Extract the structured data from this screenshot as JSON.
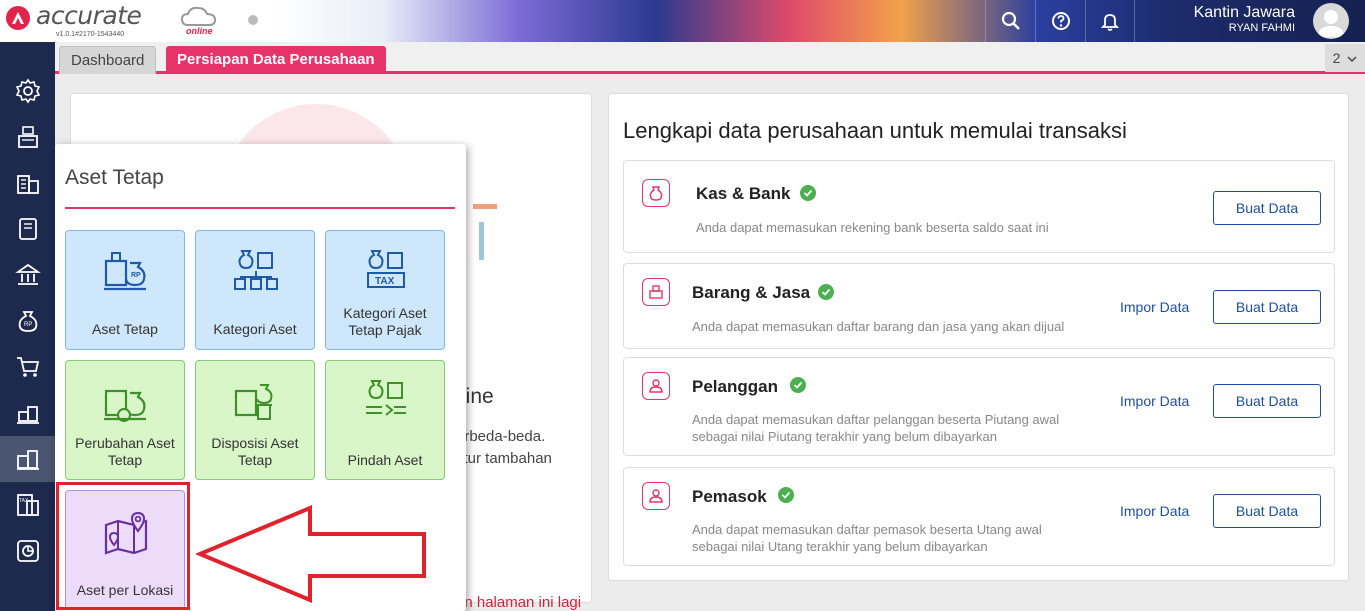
{
  "app": {
    "brand": "accurate",
    "brand_sub": "online",
    "version": "v1.0.1#2170-1543440"
  },
  "user": {
    "company": "Kantin Jawara",
    "name": "RYAN FAHMI"
  },
  "tabs": [
    {
      "label": "Dashboard"
    },
    {
      "label": "Persiapan Data Perusahaan"
    }
  ],
  "tab_count": "2",
  "left_card": {
    "text_online": "line",
    "text_line1": "erbeda-beda.",
    "text_line2": "fitur tambahan",
    "footer": "an halaman ini lagi"
  },
  "right_card": {
    "title": "Lengkapi data perusahaan untuk memulai transaksi",
    "tasks": [
      {
        "title": "Kas & Bank",
        "desc1": "Anda dapat memasukan rekening bank beserta saldo saat ini",
        "desc2": "",
        "impor": "",
        "buat": "Buat Data"
      },
      {
        "title": "Barang & Jasa",
        "desc1": "Anda dapat memasukan daftar barang dan jasa yang akan dijual",
        "desc2": "",
        "impor": "Impor Data",
        "buat": "Buat Data"
      },
      {
        "title": "Pelanggan",
        "desc1": "Anda dapat memasukan daftar pelanggan beserta Piutang awal",
        "desc2": "sebagai nilai Piutang terakhir yang belum dibayarkan",
        "impor": "Impor Data",
        "buat": "Buat Data"
      },
      {
        "title": "Pemasok",
        "desc1": "Anda dapat memasukan daftar pemasok beserta Utang awal",
        "desc2": "sebagai nilai Utang terakhir yang belum dibayarkan",
        "impor": "Impor Data",
        "buat": "Buat Data"
      }
    ]
  },
  "popup": {
    "title": "Aset Tetap",
    "tiles": [
      {
        "label1": "Aset Tetap",
        "label2": "",
        "color": "blue",
        "icon": "fixed-asset-icon"
      },
      {
        "label1": "Kategori Aset",
        "label2": "",
        "color": "blue",
        "icon": "asset-category-icon"
      },
      {
        "label1": "Kategori Aset",
        "label2": "Tetap Pajak",
        "color": "blue",
        "icon": "tax-asset-category-icon"
      },
      {
        "label1": "Perubahan Aset",
        "label2": "Tetap",
        "color": "green",
        "icon": "asset-change-icon"
      },
      {
        "label1": "Disposisi Aset",
        "label2": "Tetap",
        "color": "green",
        "icon": "asset-disposal-icon"
      },
      {
        "label1": "Pindah Aset",
        "label2": "",
        "color": "green",
        "icon": "asset-transfer-icon"
      },
      {
        "label1": "Aset per Lokasi",
        "label2": "",
        "color": "purple",
        "icon": "asset-location-map-icon"
      }
    ]
  },
  "sidebar_icons": [
    "settings-icon",
    "cashier-icon",
    "company-building-icon",
    "ledger-book-icon",
    "bank-icon",
    "money-bag-icon",
    "shopping-cart-icon",
    "inventory-icon",
    "fixed-asset-icon",
    "tax-report-icon",
    "report-chart-icon"
  ],
  "colors": {
    "accent": "#e6336a",
    "sidebar": "#1d2a4d",
    "link": "#1f4fa0",
    "check": "#4caf50",
    "highlight": "#e0222d"
  }
}
